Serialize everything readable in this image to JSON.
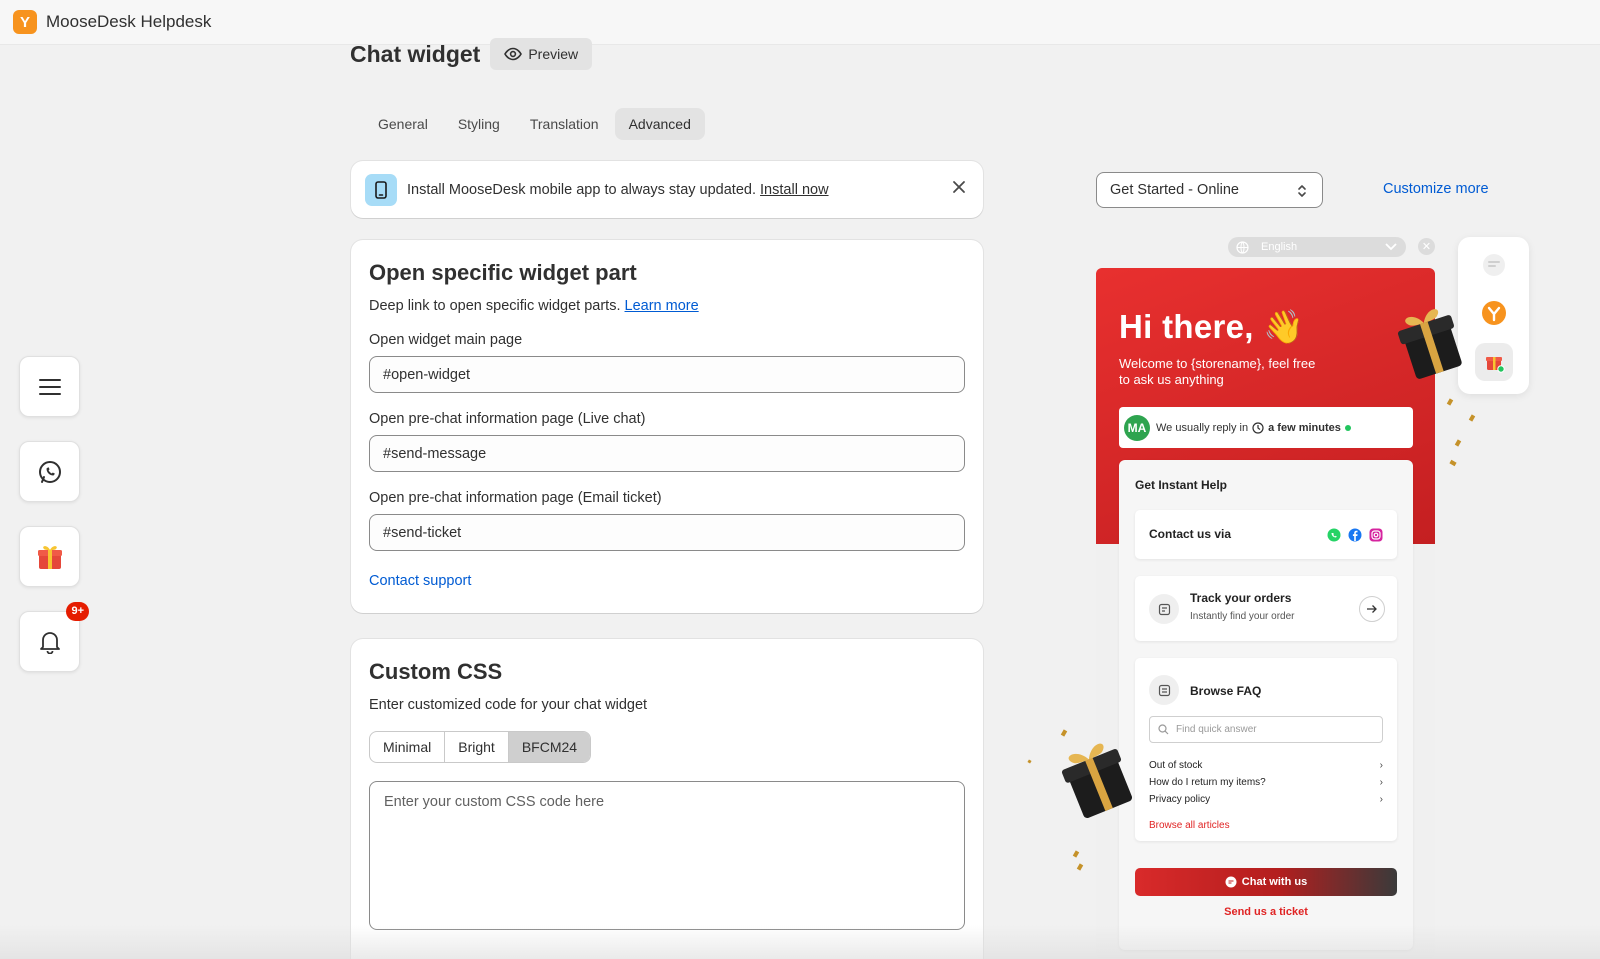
{
  "app": {
    "title": "MooseDesk Helpdesk"
  },
  "sidebar": {
    "notification_badge": "9+"
  },
  "header": {
    "title": "Chat widget",
    "preview_label": "Preview"
  },
  "tabs": [
    {
      "label": "General"
    },
    {
      "label": "Styling"
    },
    {
      "label": "Translation"
    },
    {
      "label": "Advanced",
      "active": true
    }
  ],
  "banner": {
    "text": "Install MooseDesk mobile app to always stay updated.",
    "link": "Install now"
  },
  "widget_parts": {
    "title": "Open specific widget part",
    "description": "Deep link to open specific widget parts.",
    "learn_more": "Learn more",
    "fields": [
      {
        "label": "Open widget main page",
        "value": "#open-widget"
      },
      {
        "label": "Open pre-chat information page (Live chat)",
        "value": "#send-message"
      },
      {
        "label": "Open pre-chat information page (Email ticket)",
        "value": "#send-ticket"
      }
    ],
    "contact_support": "Contact support"
  },
  "custom_css": {
    "title": "Custom CSS",
    "description": "Enter customized code for your chat widget",
    "presets": [
      {
        "label": "Minimal"
      },
      {
        "label": "Bright"
      },
      {
        "label": "BFCM24",
        "active": true
      }
    ],
    "placeholder": "Enter your custom CSS code here"
  },
  "preview_controls": {
    "status_select": "Get Started - Online",
    "customize_more": "Customize more",
    "language": "English"
  },
  "widget_preview": {
    "greeting": "Hi there, 👋",
    "welcome": "Welcome to {storename}, feel free to ask us anything",
    "avatar_initials": "MA",
    "reply_prefix": "We usually reply in",
    "reply_time": "a few minutes",
    "help_title": "Get Instant Help",
    "contact_via": "Contact us via",
    "track_title": "Track your orders",
    "track_sub": "Instantly find your order",
    "faq_title": "Browse FAQ",
    "faq_search_placeholder": "Find quick answer",
    "faq_items": [
      "Out of stock",
      "How do I return my items?",
      "Privacy policy"
    ],
    "browse_all": "Browse all articles",
    "chat_button": "Chat with us",
    "ticket_link": "Send us a ticket"
  },
  "colors": {
    "brand_orange": "#f7931e",
    "link_blue": "#005bd3",
    "widget_red": "#e8302f",
    "badge_red": "#e51c00"
  }
}
